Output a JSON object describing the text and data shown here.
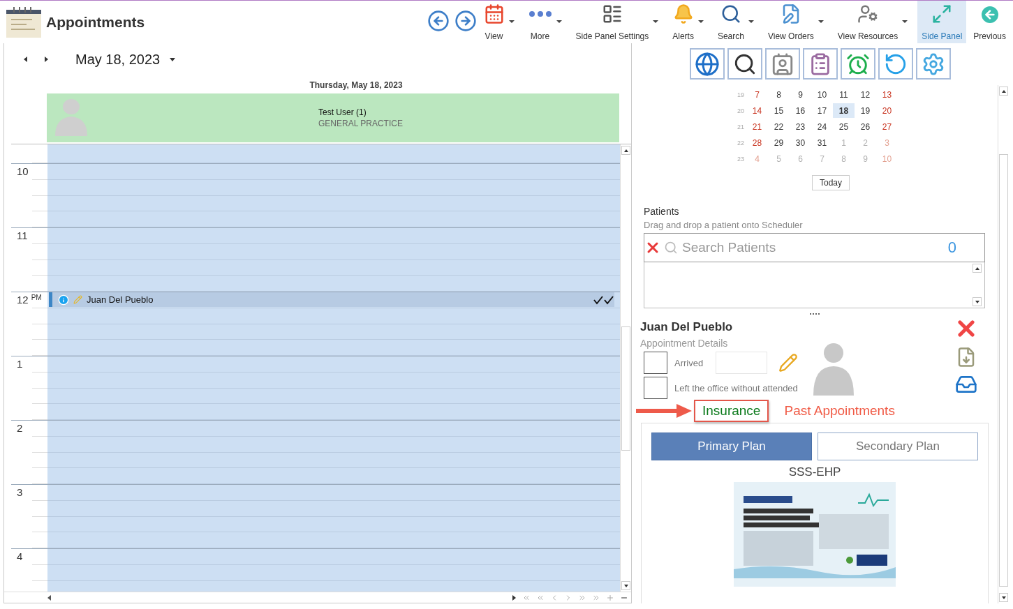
{
  "app": {
    "title": "Appointments"
  },
  "toolbar": {
    "items": [
      {
        "kind": "view",
        "label": "View",
        "dropdown": true,
        "selected": false
      },
      {
        "kind": "more",
        "label": "More",
        "dropdown": true,
        "selected": false
      },
      {
        "kind": "panel_settings",
        "label": "Side Panel Settings",
        "dropdown": true,
        "selected": false
      },
      {
        "kind": "alerts",
        "label": "Alerts",
        "dropdown": true,
        "selected": false
      },
      {
        "kind": "search",
        "label": "Search",
        "dropdown": true,
        "selected": false
      },
      {
        "kind": "orders",
        "label": "View Orders",
        "dropdown": true,
        "selected": false
      },
      {
        "kind": "resources",
        "label": "View Resources",
        "dropdown": true,
        "selected": false
      },
      {
        "kind": "side_panel",
        "label": "Side Panel",
        "dropdown": false,
        "selected": true
      },
      {
        "kind": "previous",
        "label": "Previous",
        "dropdown": false,
        "selected": false
      }
    ]
  },
  "scheduler": {
    "date": "May 18, 2023",
    "day_header": "Thursday, May 18, 2023",
    "resource": {
      "name": "Test User (1)",
      "specialty": "GENERAL PRACTICE"
    },
    "hours": [
      {
        "hour": "10"
      },
      {
        "hour": "11"
      },
      {
        "hour": "12",
        "suffix": "PM",
        "appointment": {
          "title": "Juan Del Pueblo"
        }
      },
      {
        "hour": "1"
      },
      {
        "hour": "2"
      },
      {
        "hour": "3"
      },
      {
        "hour": "4"
      }
    ]
  },
  "mini_calendar": {
    "weeks": [
      {
        "week": "19",
        "days": [
          {
            "day": "7",
            "kind": "weekend",
            "selected": false
          },
          {
            "day": "8",
            "kind": "weekday",
            "selected": false
          },
          {
            "day": "9",
            "kind": "weekday",
            "selected": false
          },
          {
            "day": "10",
            "kind": "weekday",
            "selected": false
          },
          {
            "day": "11",
            "kind": "weekday",
            "selected": false
          },
          {
            "day": "12",
            "kind": "weekday",
            "selected": false
          },
          {
            "day": "13",
            "kind": "weekend",
            "selected": false
          }
        ]
      },
      {
        "week": "20",
        "days": [
          {
            "day": "14",
            "kind": "weekend",
            "selected": false
          },
          {
            "day": "15",
            "kind": "weekday",
            "selected": false
          },
          {
            "day": "16",
            "kind": "weekday",
            "selected": false
          },
          {
            "day": "17",
            "kind": "weekday",
            "selected": false
          },
          {
            "day": "18",
            "kind": "weekday",
            "selected": true
          },
          {
            "day": "19",
            "kind": "weekday",
            "selected": false
          },
          {
            "day": "20",
            "kind": "weekend",
            "selected": false
          }
        ]
      },
      {
        "week": "21",
        "days": [
          {
            "day": "21",
            "kind": "weekend",
            "selected": false
          },
          {
            "day": "22",
            "kind": "weekday",
            "selected": false
          },
          {
            "day": "23",
            "kind": "weekday",
            "selected": false
          },
          {
            "day": "24",
            "kind": "weekday",
            "selected": false
          },
          {
            "day": "25",
            "kind": "weekday",
            "selected": false
          },
          {
            "day": "26",
            "kind": "weekday",
            "selected": false
          },
          {
            "day": "27",
            "kind": "weekend",
            "selected": false
          }
        ]
      },
      {
        "week": "22",
        "days": [
          {
            "day": "28",
            "kind": "weekend",
            "selected": false
          },
          {
            "day": "29",
            "kind": "weekday",
            "selected": false
          },
          {
            "day": "30",
            "kind": "weekday",
            "selected": false
          },
          {
            "day": "31",
            "kind": "weekday",
            "selected": false
          },
          {
            "day": "1",
            "kind": "other_month",
            "selected": false
          },
          {
            "day": "2",
            "kind": "other_month",
            "selected": false
          },
          {
            "day": "3",
            "kind": "other_weekend",
            "selected": false
          }
        ]
      },
      {
        "week": "23",
        "days": [
          {
            "day": "4",
            "kind": "other_weekend",
            "selected": false
          },
          {
            "day": "5",
            "kind": "other_month",
            "selected": false
          },
          {
            "day": "6",
            "kind": "other_month",
            "selected": false
          },
          {
            "day": "7",
            "kind": "other_month",
            "selected": false
          },
          {
            "day": "8",
            "kind": "other_month",
            "selected": false
          },
          {
            "day": "9",
            "kind": "other_month",
            "selected": false
          },
          {
            "day": "10",
            "kind": "other_weekend",
            "selected": false
          }
        ]
      }
    ],
    "today_button": "Today"
  },
  "patients": {
    "title": "Patients",
    "hint": "Drag and drop a patient onto Scheduler",
    "search": {
      "placeholder": "Search Patients"
    },
    "count": "0"
  },
  "appointment": {
    "patient": "Juan Del Pueblo",
    "subtitle": "Appointment Details",
    "checks": [
      {
        "label": "Arrived",
        "checked": false,
        "has_time": true
      },
      {
        "label": "Left the office without attended",
        "checked": false,
        "has_time": false
      }
    ],
    "tabs": [
      {
        "label": "Insurance",
        "selected": true
      },
      {
        "label": "Past Appointments",
        "selected": false
      }
    ],
    "plans": [
      {
        "label": "Primary Plan",
        "selected": true
      },
      {
        "label": "Secondary Plan",
        "selected": false
      }
    ],
    "plan_name": "SSS-EHP"
  }
}
